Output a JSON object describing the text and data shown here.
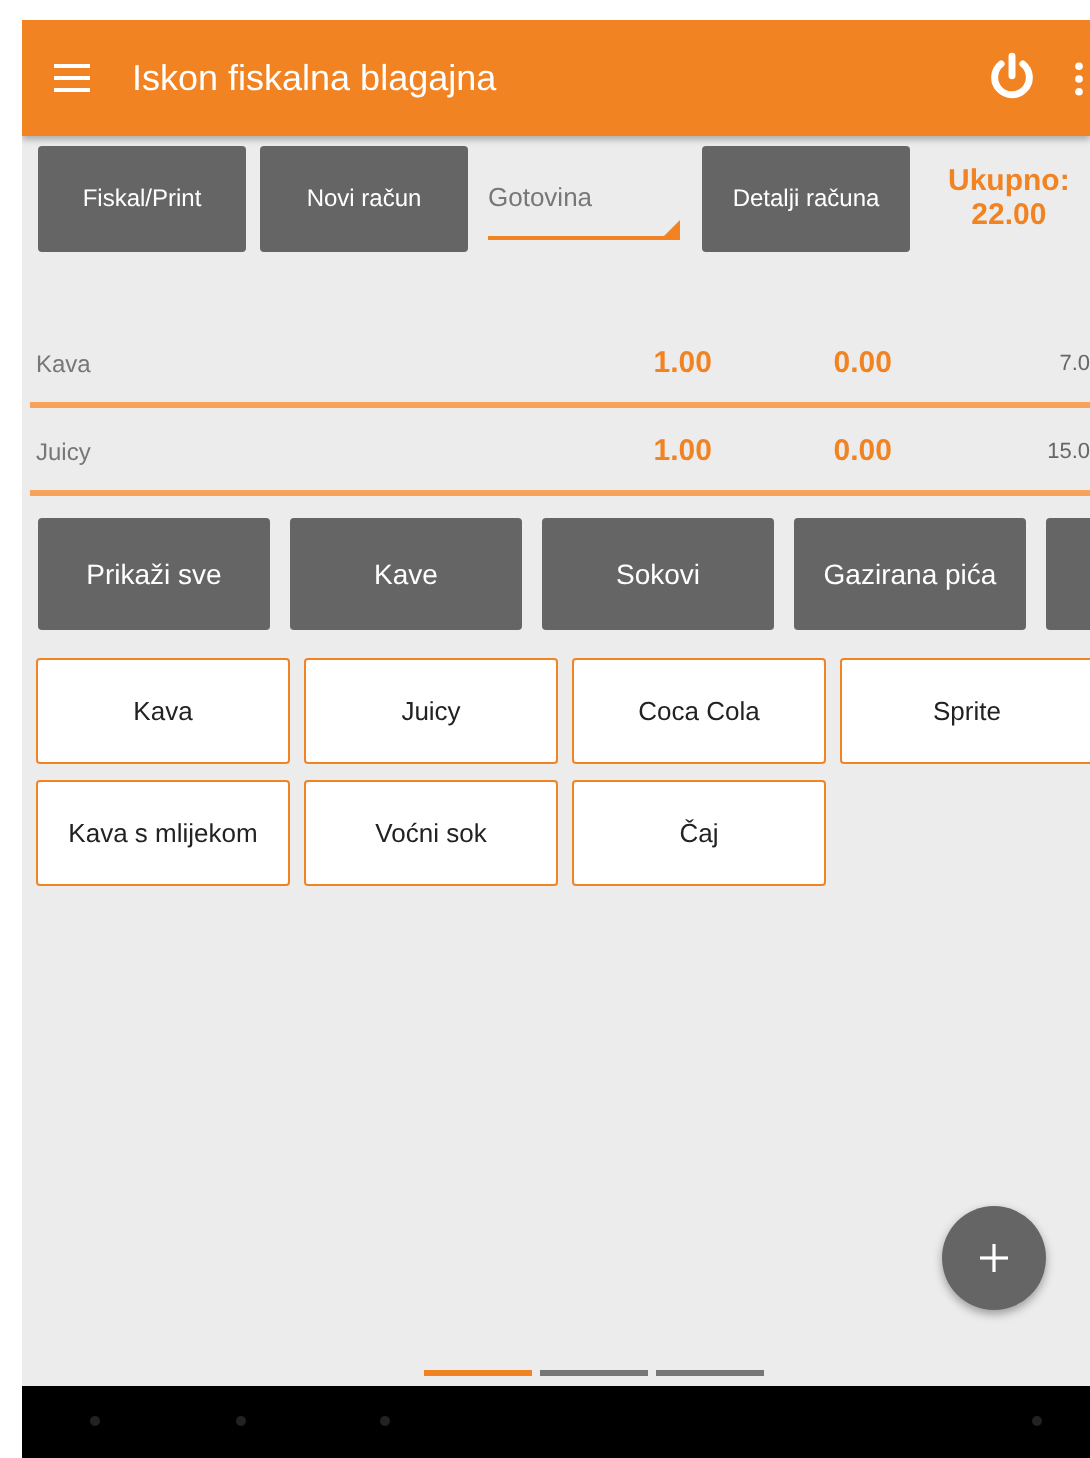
{
  "app_bar": {
    "title": "Iskon fiskalna blagajna"
  },
  "toolbar": {
    "buttons": [
      "Fiskal/Print",
      "Novi račun"
    ],
    "payment": {
      "value": "Gotovina"
    },
    "details_button": "Detalji računa",
    "total_label": "Ukupno:",
    "total_value": "22.00"
  },
  "order_rows": [
    {
      "name": "Kava",
      "quantity": "1.00",
      "discount": "0.00",
      "price": "7.0"
    },
    {
      "name": "Juicy",
      "quantity": "1.00",
      "discount": "0.00",
      "price": "15.0"
    }
  ],
  "categories": [
    {
      "kind": "button",
      "label": "Prikaži sve"
    },
    {
      "kind": "button",
      "label": "Kave"
    },
    {
      "kind": "button",
      "label": "Sokovi"
    },
    {
      "kind": "button",
      "label": "Gazirana pića"
    },
    {
      "kind": "partial"
    }
  ],
  "products": [
    "Kava",
    "Juicy",
    "Coca Cola",
    "Sprite",
    "Kava s mlijekom",
    "Voćni sok",
    "Čaj"
  ],
  "pages": [
    {
      "selected": true
    },
    {
      "selected": false
    },
    {
      "selected": false
    }
  ]
}
